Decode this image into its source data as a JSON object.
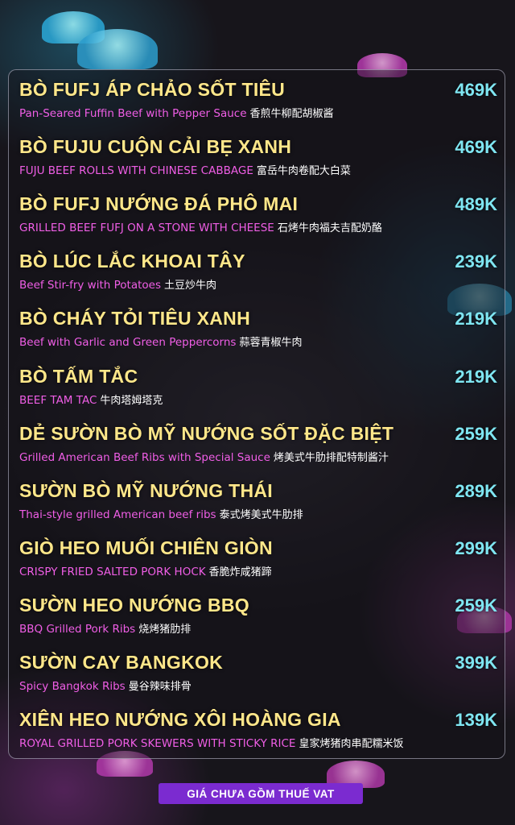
{
  "menu": {
    "items": [
      {
        "name": "BÒ FUFJ ÁP CHẢO SỐT TIÊU",
        "price": "469K",
        "desc": "Pan-Seared Fuffin Beef with Pepper Sauce",
        "zh": "香煎牛柳配胡椒酱"
      },
      {
        "name": "BÒ FUJU CUỘN CẢI BẸ XANH",
        "price": "469K",
        "desc": "FUJU BEEF ROLLS WITH CHINESE CABBAGE",
        "zh": "富岳牛肉卷配大白菜"
      },
      {
        "name": "BÒ FUFJ NƯỚNG ĐÁ PHÔ MAI",
        "price": "489K",
        "desc": "GRILLED BEEF FUFJ ON A STONE WITH CHEESE",
        "zh": "石烤牛肉福夫吉配奶酪"
      },
      {
        "name": "BÒ LÚC LẮC KHOAI TÂY",
        "price": "239K",
        "desc": "Beef Stir-fry with Potatoes",
        "zh": "土豆炒牛肉"
      },
      {
        "name": "BÒ CHÁY TỎI TIÊU XANH",
        "price": "219K",
        "desc": "Beef with Garlic and Green Peppercorns",
        "zh": "蒜蓉青椒牛肉"
      },
      {
        "name": "BÒ TẤM TẮC",
        "price": "219K",
        "desc": "BEEF TAM TAC",
        "zh": "牛肉塔姆塔克"
      },
      {
        "name": "DẺ SƯỜN BÒ MỸ NƯỚNG SỐT ĐẶC BIỆT",
        "price": "259K",
        "desc": "Grilled American Beef Ribs with Special Sauce",
        "zh": "烤美式牛肋排配特制酱汁"
      },
      {
        "name": "SƯỜN BÒ MỸ NƯỚNG THÁI",
        "price": "289K",
        "desc": "Thai-style grilled American beef ribs",
        "zh": "泰式烤美式牛肋排"
      },
      {
        "name": "GIÒ HEO MUỐI CHIÊN GIÒN",
        "price": "299K",
        "desc": "CRISPY FRIED SALTED PORK HOCK",
        "zh": "香脆炸咸猪蹄"
      },
      {
        "name": "SƯỜN HEO NƯỚNG BBQ",
        "price": "259K",
        "desc": "BBQ Grilled Pork Ribs",
        "zh": "烧烤猪肋排"
      },
      {
        "name": "SƯỜN CAY BANGKOK",
        "price": "399K",
        "desc": "Spicy Bangkok Ribs",
        "zh": "曼谷辣味排骨"
      },
      {
        "name": "XIÊN HEO NƯỚNG XÔI HOÀNG GIA",
        "price": "139K",
        "desc": "ROYAL GRILLED PORK SKEWERS WITH STICKY RICE",
        "zh": "皇家烤猪肉串配糯米饭"
      }
    ]
  },
  "footer": {
    "note": "GIÁ CHƯA GỒM THUẾ VAT"
  },
  "colors": {
    "name": "#ffe78a",
    "price": "#7fe6f2",
    "desc": "#f05ee6",
    "footer_bg": "#7b2bd0"
  }
}
